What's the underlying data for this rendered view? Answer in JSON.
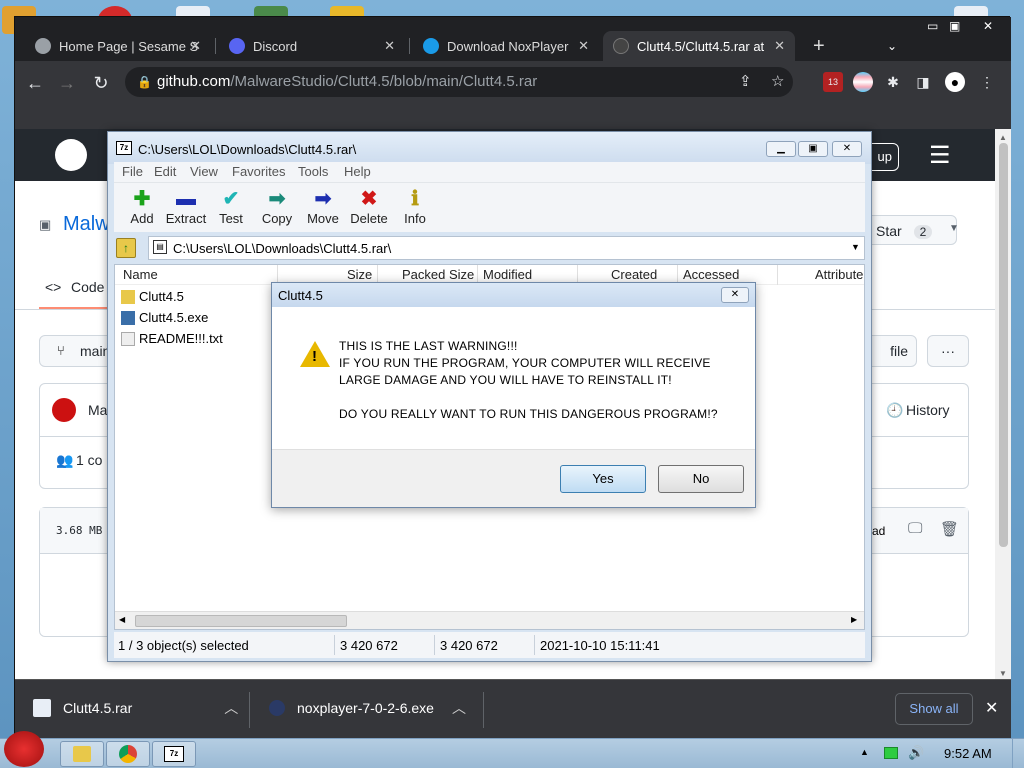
{
  "browser": {
    "tabs": [
      {
        "title": "Home Page | Sesame S",
        "fav_color": "#9aa0a6"
      },
      {
        "title": "Discord",
        "fav_color": "#5865f2"
      },
      {
        "title": "Download NoxPlayer",
        "fav_color": "#1a9be8"
      },
      {
        "title": "Clutt4.5/Clutt4.5.rar at",
        "fav_color": "#444"
      }
    ],
    "new_tab": "+",
    "url_host": "github.com",
    "url_path": "/MalwareStudio/Clutt4.5/blob/main/Clutt4.5.rar",
    "ext_badge": "13"
  },
  "github": {
    "repo_prefix": "Malw",
    "code_tab": "Code",
    "branch": "main",
    "star_label": "Star",
    "star_count": "2",
    "signup_frag": "up",
    "file_btn": "file",
    "more_btn": "···",
    "history_label": "History",
    "author_frag": "Ma",
    "contrib_frag": "1 co",
    "size": "3.68 MB",
    "download_frag": "ad"
  },
  "sevenzip": {
    "title": "C:\\Users\\LOL\\Downloads\\Clutt4.5.rar\\",
    "menu": [
      "File",
      "Edit",
      "View",
      "Favorites",
      "Tools",
      "Help"
    ],
    "tools": [
      {
        "label": "Add",
        "glyph": "✚",
        "color": "#1aa31a"
      },
      {
        "label": "Extract",
        "glyph": "▬",
        "color": "#1d2fb0"
      },
      {
        "label": "Test",
        "glyph": "✔",
        "color": "#1fb5b5"
      },
      {
        "label": "Copy",
        "glyph": "➡",
        "color": "#1a8a7a"
      },
      {
        "label": "Move",
        "glyph": "➡",
        "color": "#1d2fb0"
      },
      {
        "label": "Delete",
        "glyph": "✖",
        "color": "#d01818"
      },
      {
        "label": "Info",
        "glyph": "ℹ",
        "color": "#b59b12"
      }
    ],
    "path": "C:\\Users\\LOL\\Downloads\\Clutt4.5.rar\\",
    "columns": [
      "Name",
      "Size",
      "Packed Size",
      "Modified",
      "Created",
      "Accessed",
      "Attribute"
    ],
    "files": [
      "Clutt4.5",
      "Clutt4.5.exe",
      "README!!!.txt"
    ],
    "status": {
      "selected": "1 / 3 object(s) selected",
      "size": "3 420 672",
      "packed": "3 420 672",
      "modified": "2021-10-10 15:11:41"
    }
  },
  "dialog": {
    "title": "Clutt4.5",
    "lines": [
      "THIS IS THE LAST WARNING!!!",
      "IF YOU RUN THE PROGRAM, YOUR COMPUTER WILL RECEIVE",
      "LARGE DAMAGE AND YOU WILL HAVE TO REINSTALL IT!",
      "DO YOU REALLY WANT TO RUN THIS DANGEROUS PROGRAM!?"
    ],
    "yes": "Yes",
    "no": "No"
  },
  "downloads": {
    "items": [
      "Clutt4.5.rar",
      "noxplayer-7-0-2-6.exe"
    ],
    "show_all": "Show all"
  },
  "taskbar": {
    "clock": "9:52 AM"
  }
}
